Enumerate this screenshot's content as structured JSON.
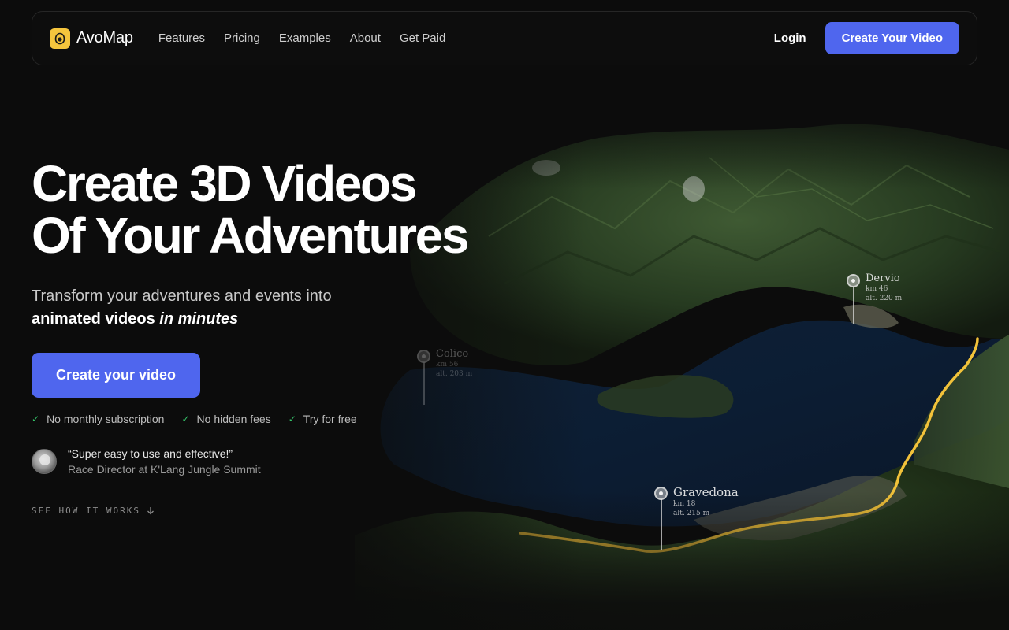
{
  "nav": {
    "brand": "AvoMap",
    "links": [
      "Features",
      "Pricing",
      "Examples",
      "About",
      "Get Paid"
    ],
    "login": "Login",
    "cta": "Create Your Video"
  },
  "hero": {
    "title_line1": "Create 3D Videos",
    "title_line2": "Of Your Adventures",
    "sub_line1": "Transform your adventures and events into",
    "sub_strong": "animated videos",
    "sub_em": "in minutes",
    "cta": "Create your video",
    "checks": [
      "No monthly subscription",
      "No hidden fees",
      "Try for free"
    ],
    "testimonial": {
      "quote": "“Super easy to use and effective!”",
      "author": "Race Director at K'Lang Jungle Summit"
    },
    "see_how": "SEE HOW IT WORKS"
  },
  "map": {
    "markers": [
      {
        "name": "Dervio",
        "km": "km 46",
        "alt": "alt. 220 m"
      },
      {
        "name": "Colico",
        "km": "km 56",
        "alt": "alt. 203 m"
      },
      {
        "name": "Gravedona",
        "km": "km 18",
        "alt": "alt. 215 m"
      }
    ]
  },
  "colors": {
    "accent": "#4f66ee",
    "brand_icon": "#f5c53d",
    "check": "#35c46a",
    "route": "#f2c23a"
  }
}
